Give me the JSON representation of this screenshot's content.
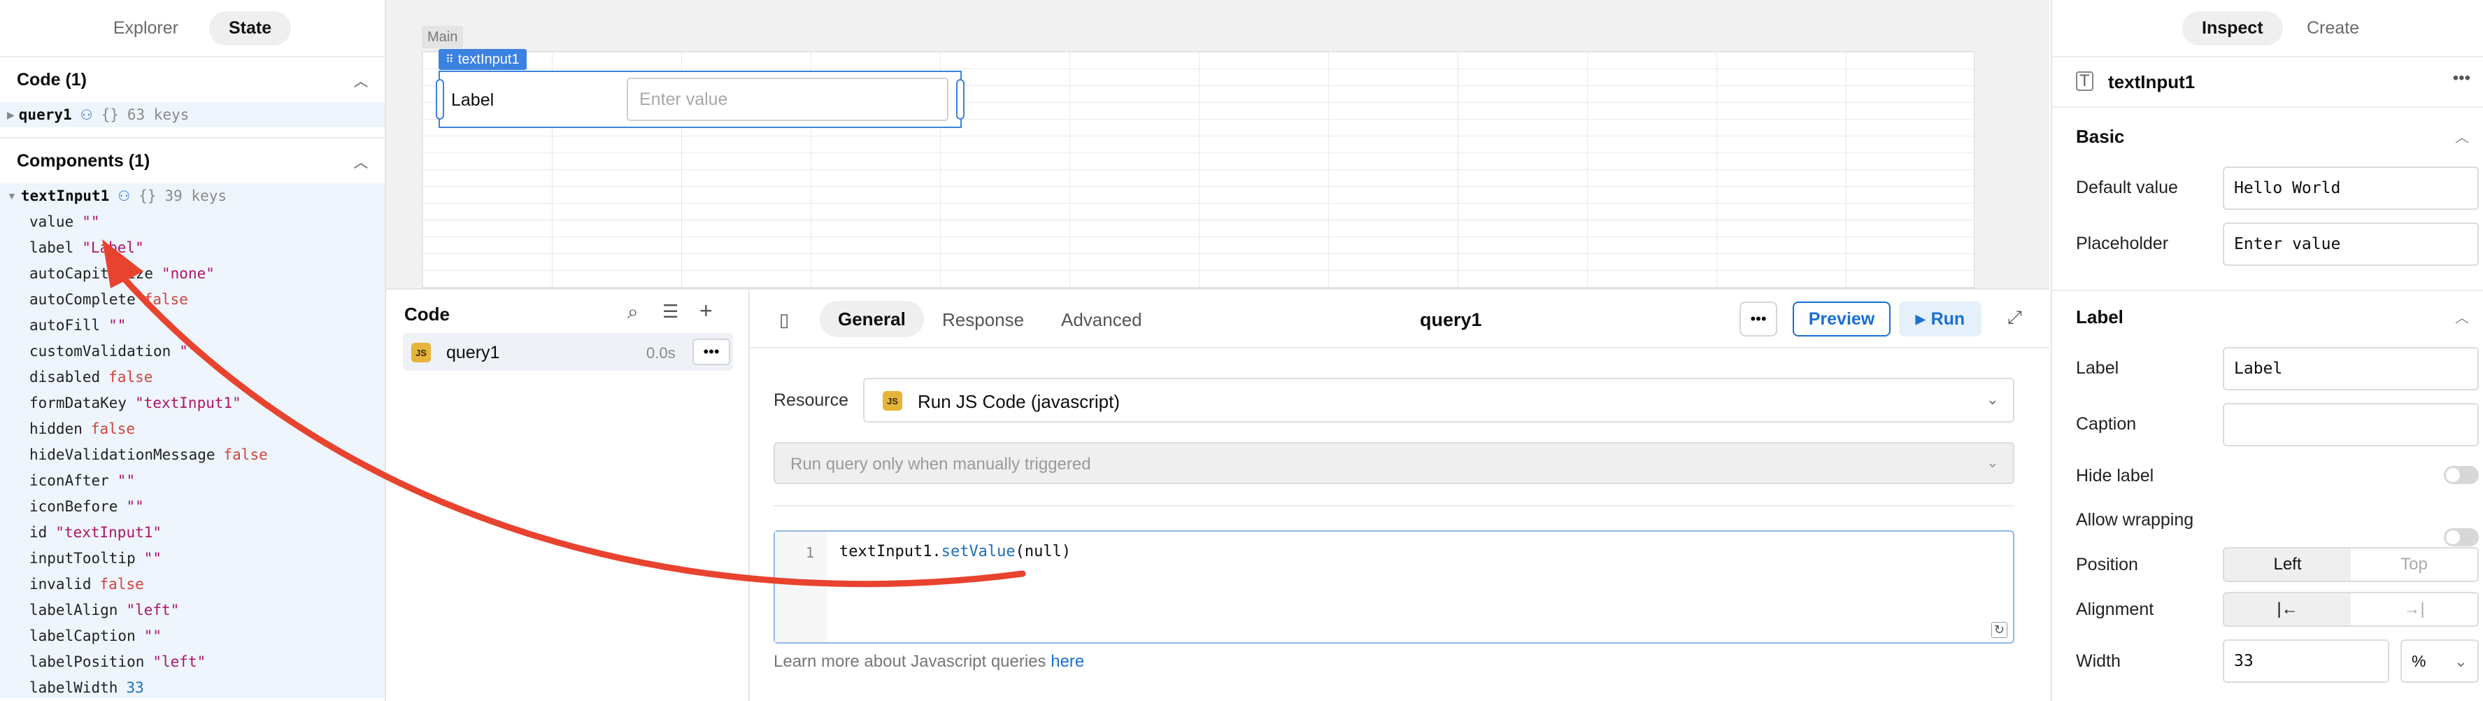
{
  "left": {
    "tabs": [
      "Explorer",
      "State"
    ],
    "code_section": {
      "title": "Code (1)",
      "item": "query1",
      "braces": "{}",
      "keys": "63 keys"
    },
    "components_section": {
      "title": "Components (1)",
      "item": "textInput1",
      "braces": "{}",
      "keys": "39 keys"
    },
    "props": [
      {
        "k": "value",
        "v": "\"\"",
        "t": "s"
      },
      {
        "k": "label",
        "v": "\"Label\"",
        "t": "s"
      },
      {
        "k": "autoCapitalize",
        "v": "\"none\"",
        "t": "s"
      },
      {
        "k": "autoComplete",
        "v": "false",
        "t": "b"
      },
      {
        "k": "autoFill",
        "v": "\"\"",
        "t": "s"
      },
      {
        "k": "customValidation",
        "v": "\"\"",
        "t": "s"
      },
      {
        "k": "disabled",
        "v": "false",
        "t": "b"
      },
      {
        "k": "formDataKey",
        "v": "\"textInput1\"",
        "t": "s"
      },
      {
        "k": "hidden",
        "v": "false",
        "t": "b"
      },
      {
        "k": "hideValidationMessage",
        "v": "false",
        "t": "b"
      },
      {
        "k": "iconAfter",
        "v": "\"\"",
        "t": "s"
      },
      {
        "k": "iconBefore",
        "v": "\"\"",
        "t": "s"
      },
      {
        "k": "id",
        "v": "\"textInput1\"",
        "t": "s"
      },
      {
        "k": "inputTooltip",
        "v": "\"\"",
        "t": "s"
      },
      {
        "k": "invalid",
        "v": "false",
        "t": "b"
      },
      {
        "k": "labelAlign",
        "v": "\"left\"",
        "t": "s"
      },
      {
        "k": "labelCaption",
        "v": "\"\"",
        "t": "s"
      },
      {
        "k": "labelPosition",
        "v": "\"left\"",
        "t": "s"
      },
      {
        "k": "labelWidth",
        "v": "33",
        "t": "n"
      }
    ]
  },
  "canvas": {
    "frame_label": "Main",
    "component_tag": "textInput1",
    "widget_label": "Label",
    "widget_placeholder": "Enter value"
  },
  "code_panel": {
    "title": "Code",
    "query_name": "query1",
    "query_time": "0.0s",
    "js_badge": "JS",
    "tabs": [
      "General",
      "Response",
      "Advanced"
    ],
    "editor_title": "query1",
    "preview_label": "Preview",
    "run_label": "Run",
    "resource_label": "Resource",
    "resource_value": "Run JS Code (javascript)",
    "trigger_value": "Run query only when manually triggered",
    "line_number": "1",
    "code": {
      "obj": "textInput1",
      "dot": ".",
      "method": "setValue",
      "args": "(null)"
    },
    "learn_more_prefix": "Learn more about Javascript queries ",
    "learn_more_link": "here"
  },
  "right": {
    "tabs": [
      "Inspect",
      "Create"
    ],
    "component_name": "textInput1",
    "basic_title": "Basic",
    "default_value_label": "Default value",
    "default_value": "Hello World",
    "placeholder_label": "Placeholder",
    "placeholder_value": "Enter value",
    "label_section_title": "Label",
    "label_label": "Label",
    "label_value": "Label",
    "caption_label": "Caption",
    "caption_value": "",
    "hide_label": "Hide label",
    "allow_wrapping": "Allow wrapping",
    "position_label": "Position",
    "position_options": [
      "Left",
      "Top"
    ],
    "alignment_label": "Alignment",
    "alignment_options": [
      "|←",
      "→|"
    ],
    "width_label": "Width",
    "width_value": "33",
    "width_unit": "%"
  },
  "colors": {
    "accent": "#1a6fd4",
    "arrow": "#e8432f",
    "selected_bg": "#eef5fc"
  }
}
